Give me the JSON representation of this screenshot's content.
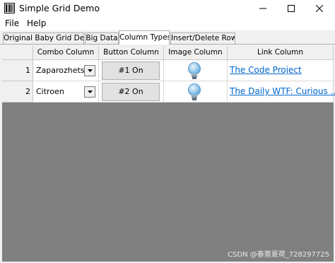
{
  "window": {
    "title": "Simple Grid Demo"
  },
  "menu": [
    "File",
    "Help"
  ],
  "tabs": [
    {
      "label": "Original Baby Grid Demo",
      "active": false
    },
    {
      "label": "Big Data",
      "active": false
    },
    {
      "label": "Column Types",
      "active": true
    },
    {
      "label": "Insert/Delete Rows",
      "active": false
    }
  ],
  "grid": {
    "columns": [
      "Combo Column",
      "Button Column",
      "Image Column",
      "Link Column"
    ],
    "rows": [
      {
        "num": "1",
        "combo": "Zaparozhets",
        "button": "#1 On",
        "image_icon": "lightbulb-icon",
        "link": "The Code Project"
      },
      {
        "num": "2",
        "combo": "Citroen",
        "button": "#2 On",
        "image_icon": "lightbulb-icon",
        "link": "The Daily WTF: Curious ..."
      }
    ]
  },
  "watermark": "CSDN @春蕾夏荷_728297725",
  "colors": {
    "link": "#0066cc",
    "grid_background": "#808080"
  }
}
